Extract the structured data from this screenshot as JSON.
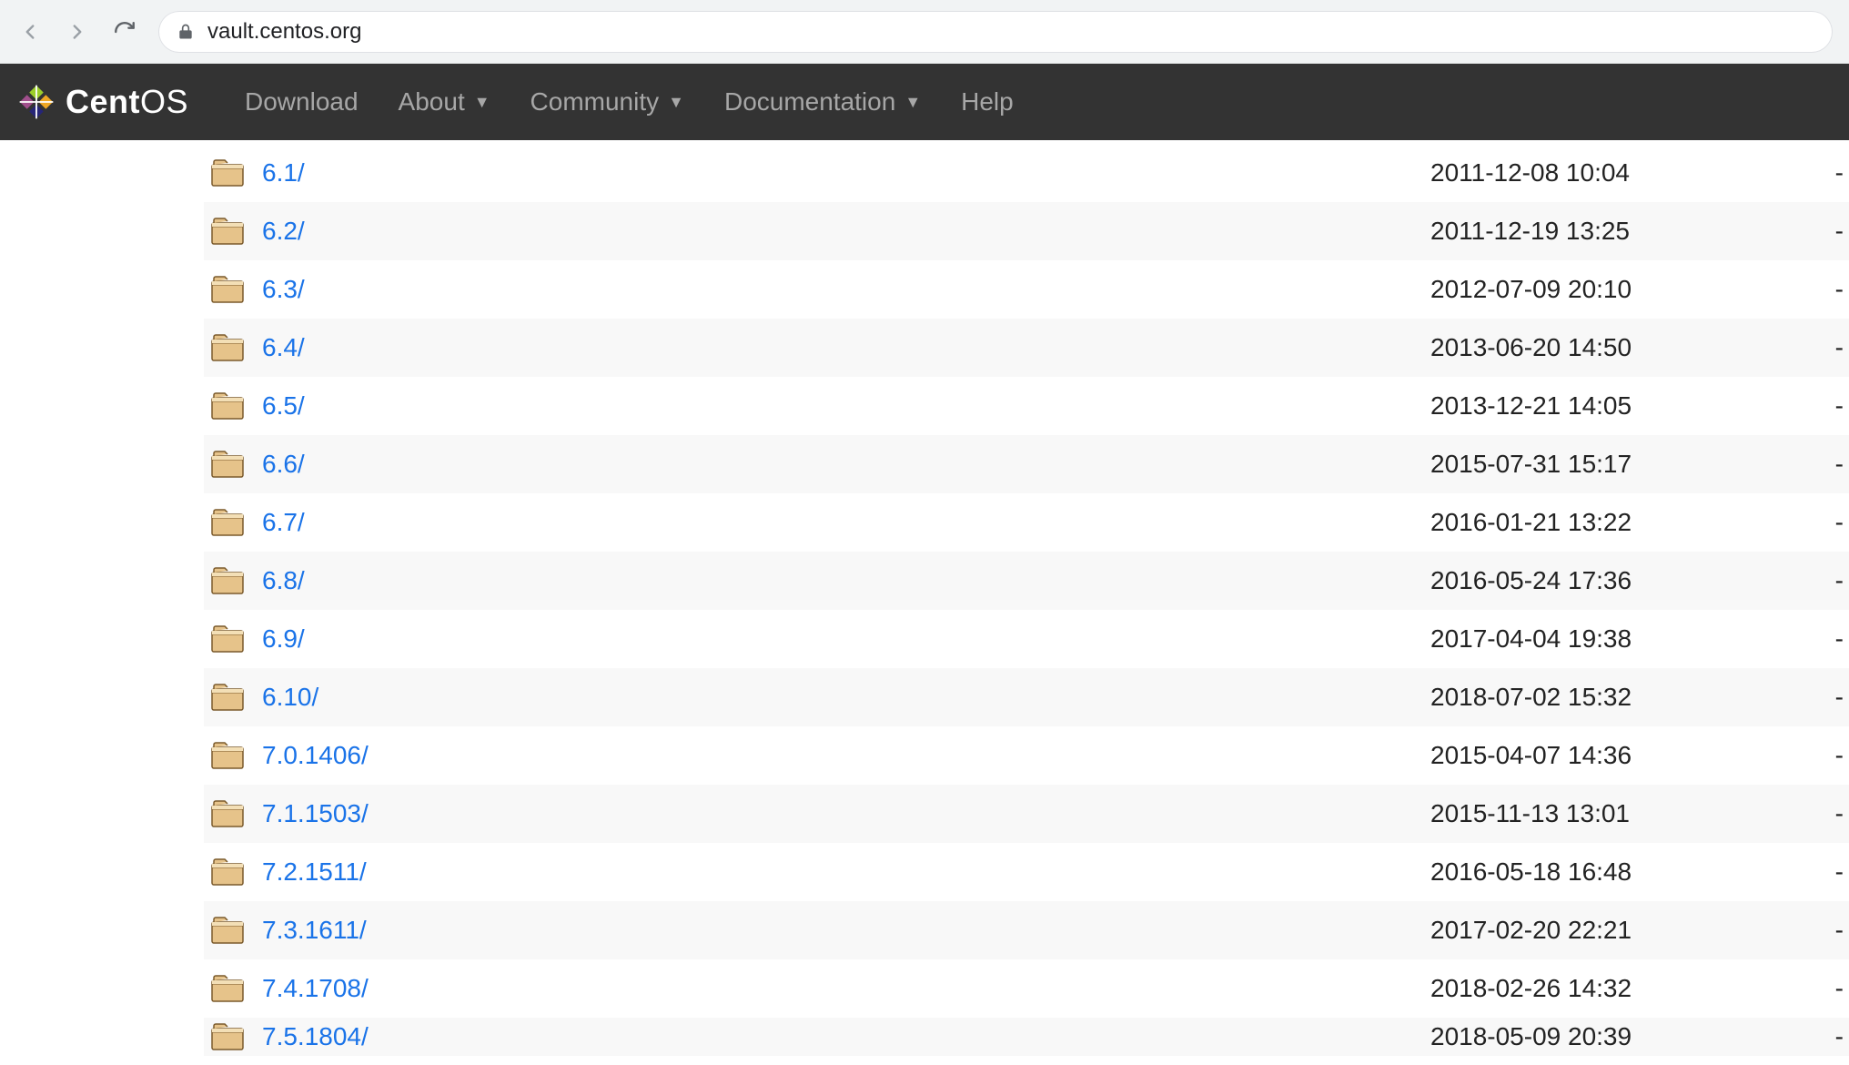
{
  "browser": {
    "url": "vault.centos.org"
  },
  "nav": {
    "items": [
      {
        "label": "Download",
        "dropdown": false
      },
      {
        "label": "About",
        "dropdown": true
      },
      {
        "label": "Community",
        "dropdown": true
      },
      {
        "label": "Documentation",
        "dropdown": true
      },
      {
        "label": "Help",
        "dropdown": false
      }
    ],
    "brand_a": "Cent",
    "brand_b": "OS"
  },
  "listing": {
    "rows": [
      {
        "name": "6.1/",
        "date": "2011-12-08 10:04",
        "size": "-"
      },
      {
        "name": "6.2/",
        "date": "2011-12-19 13:25",
        "size": "-"
      },
      {
        "name": "6.3/",
        "date": "2012-07-09 20:10",
        "size": "-"
      },
      {
        "name": "6.4/",
        "date": "2013-06-20 14:50",
        "size": "-"
      },
      {
        "name": "6.5/",
        "date": "2013-12-21 14:05",
        "size": "-"
      },
      {
        "name": "6.6/",
        "date": "2015-07-31 15:17",
        "size": "-"
      },
      {
        "name": "6.7/",
        "date": "2016-01-21 13:22",
        "size": "-"
      },
      {
        "name": "6.8/",
        "date": "2016-05-24 17:36",
        "size": "-"
      },
      {
        "name": "6.9/",
        "date": "2017-04-04 19:38",
        "size": "-"
      },
      {
        "name": "6.10/",
        "date": "2018-07-02 15:32",
        "size": "-"
      },
      {
        "name": "7.0.1406/",
        "date": "2015-04-07 14:36",
        "size": "-"
      },
      {
        "name": "7.1.1503/",
        "date": "2015-11-13 13:01",
        "size": "-"
      },
      {
        "name": "7.2.1511/",
        "date": "2016-05-18 16:48",
        "size": "-"
      },
      {
        "name": "7.3.1611/",
        "date": "2017-02-20 22:21",
        "size": "-"
      },
      {
        "name": "7.4.1708/",
        "date": "2018-02-26 14:32",
        "size": "-"
      },
      {
        "name": "7.5.1804/",
        "date": "2018-05-09 20:39",
        "size": "-"
      }
    ]
  }
}
